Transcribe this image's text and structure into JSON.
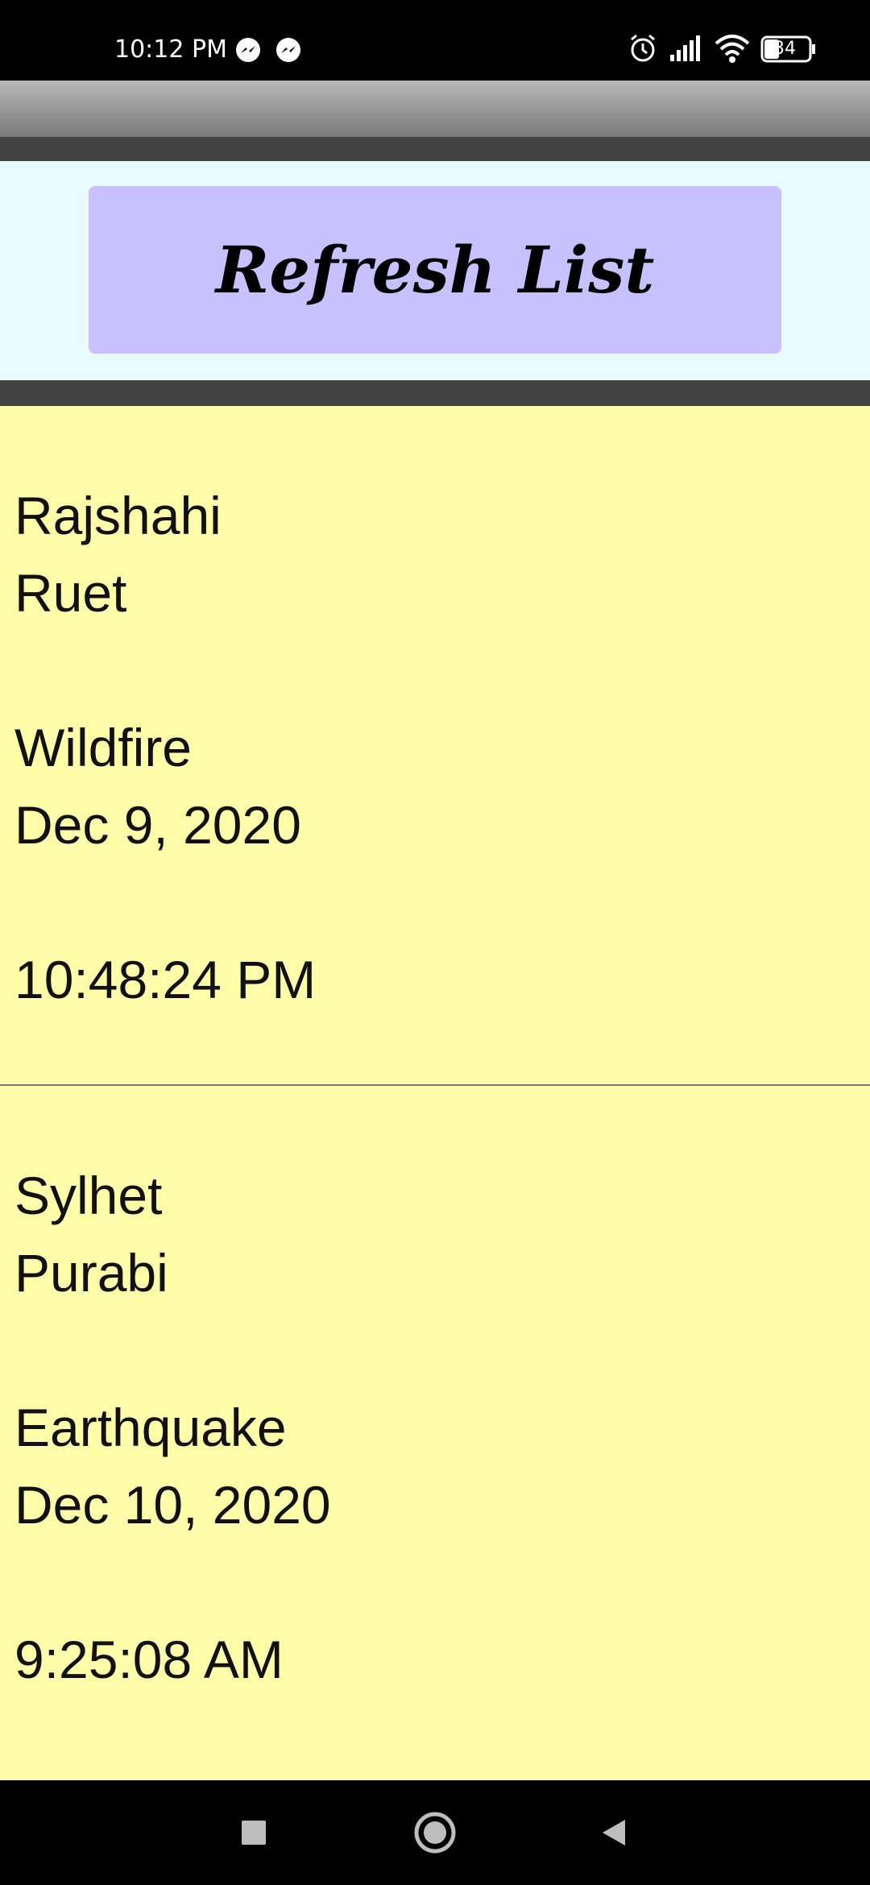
{
  "status_bar": {
    "time": "10:12 PM",
    "notification_icons": [
      "messenger-icon",
      "messenger-icon"
    ],
    "right_icons": [
      "alarm-icon",
      "signal-icon",
      "wifi-icon",
      "battery-icon"
    ],
    "battery_level": "34"
  },
  "header": {
    "refresh_label": "Refresh List"
  },
  "list": {
    "items": [
      {
        "division": "Rajshahi",
        "location": "Ruet",
        "disaster": "Wildfire",
        "date": "Dec 9, 2020",
        "time": "10:48:24 PM"
      },
      {
        "division": "Sylhet",
        "location": "Purabi",
        "disaster": "Earthquake",
        "date": "Dec 10, 2020",
        "time": "9:25:08 AM"
      }
    ]
  },
  "nav_bar": {
    "buttons": [
      "recents-square-icon",
      "home-circle-icon",
      "back-triangle-icon"
    ]
  },
  "colors": {
    "list_background": "#fffcaa",
    "header_background": "#e8fbff",
    "button_background": "#c8c0ff",
    "divider": "#434343"
  }
}
